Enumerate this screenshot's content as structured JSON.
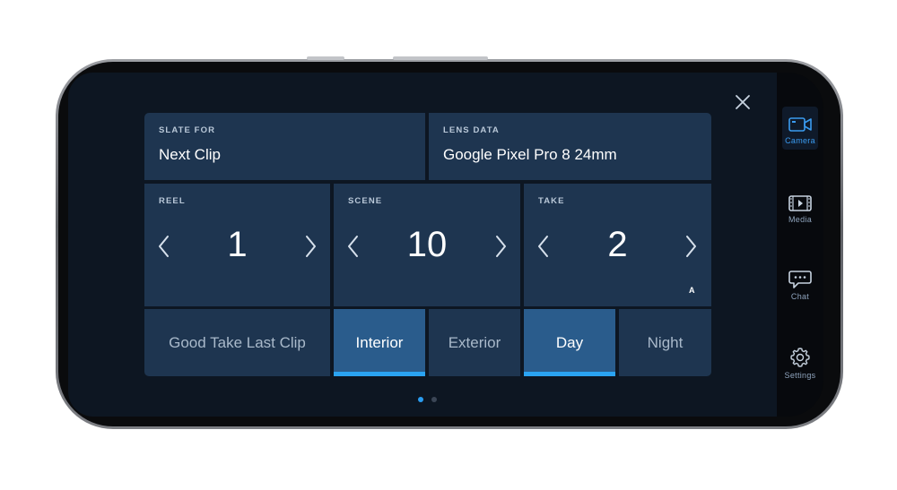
{
  "slate": {
    "slate_for": {
      "label": "SLATE FOR",
      "value": "Next Clip"
    },
    "lens_data": {
      "label": "LENS DATA",
      "value": "Google Pixel Pro 8 24mm"
    },
    "reel": {
      "label": "REEL",
      "value": "1"
    },
    "scene": {
      "label": "SCENE",
      "value": "10"
    },
    "take": {
      "label": "TAKE",
      "value": "2",
      "tag": "A"
    },
    "good_take": {
      "label": "Good Take Last Clip",
      "active": false
    },
    "interior": {
      "label": "Interior",
      "active": true
    },
    "exterior": {
      "label": "Exterior",
      "active": false
    },
    "day": {
      "label": "Day",
      "active": true
    },
    "night": {
      "label": "Night",
      "active": false
    }
  },
  "pager": {
    "pages": 2,
    "current": 1
  },
  "nav_rail": {
    "camera": {
      "label": "Camera",
      "icon": "camera-icon",
      "active": true
    },
    "media": {
      "label": "Media",
      "icon": "film-icon",
      "active": false
    },
    "chat": {
      "label": "Chat",
      "icon": "chat-icon",
      "active": false
    },
    "settings": {
      "label": "Settings",
      "icon": "gear-icon",
      "active": false
    }
  },
  "colors": {
    "card": "#1e3550",
    "toggle_on": "#2a5c8c",
    "accent": "#2aa3f2",
    "rail_active": "#3a9bf0",
    "screen_bg": "#0d1622"
  }
}
